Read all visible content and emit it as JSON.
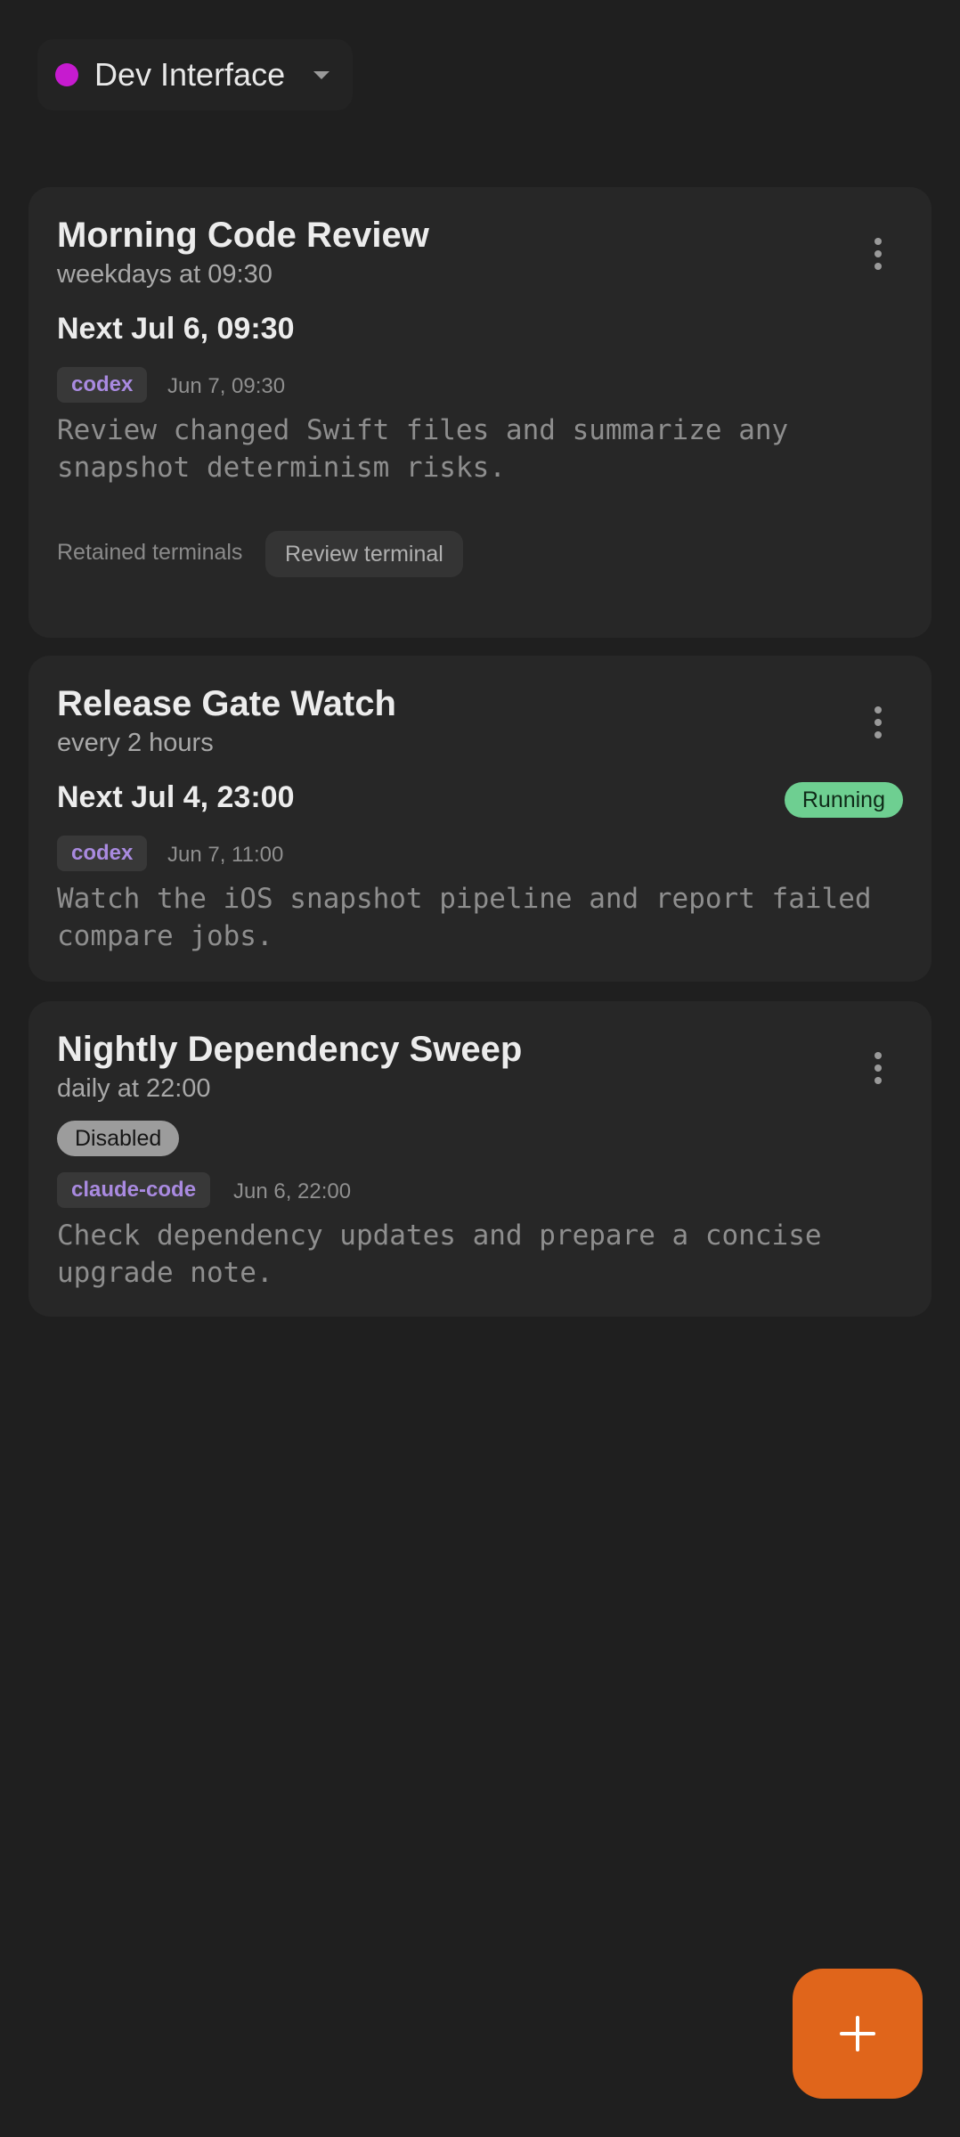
{
  "workspace": {
    "name": "Dev Interface",
    "color": "#c61bcf"
  },
  "automations": [
    {
      "title": "Morning Code Review",
      "schedule": "weekdays at 09:30",
      "next": "Next Jul 6, 09:30",
      "agent": "codex",
      "last_run": "Jun 7, 09:30",
      "prompt": "Review changed Swift files and summarize any snapshot determinism risks.",
      "retained_label": "Retained terminals",
      "retained_terminal": "Review terminal"
    },
    {
      "title": "Release Gate Watch",
      "schedule": "every 2 hours",
      "next": "Next Jul 4, 23:00",
      "status": "Running",
      "agent": "codex",
      "last_run": "Jun 7, 11:00",
      "prompt": "Watch the iOS snapshot pipeline and report failed compare jobs."
    },
    {
      "title": "Nightly Dependency Sweep",
      "schedule": "daily at 22:00",
      "status": "Disabled",
      "agent": "claude-code",
      "last_run": "Jun 6, 22:00",
      "prompt": "Check dependency updates and prepare a concise upgrade note."
    }
  ],
  "fab": {
    "icon": "plus-icon",
    "color": "#e0651b"
  },
  "colors": {
    "background": "#1f1f1f",
    "card": "#272727",
    "agent_text": "#a98ae0",
    "running": "#6ecf91",
    "disabled": "#9c9c9c"
  }
}
